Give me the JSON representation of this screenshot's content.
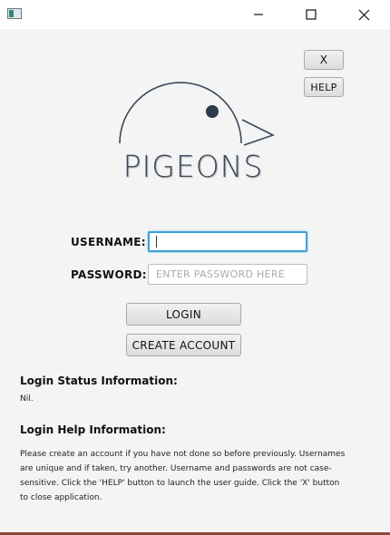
{
  "window": {
    "controls": {
      "minimize_icon": "minimize-icon",
      "maximize_icon": "maximize-icon",
      "close_icon": "close-icon"
    }
  },
  "header_buttons": {
    "close_label": "X",
    "help_label": "HELP"
  },
  "logo": {
    "text": "PIGEONS",
    "colors": {
      "stroke": "#3a4a5c",
      "eye": "#2b3a4c"
    }
  },
  "login_form": {
    "username_label": "USERNAME:",
    "username_value": "",
    "password_label": "PASSWORD:",
    "password_placeholder": "ENTER PASSWORD HERE",
    "login_button": "LOGIN",
    "create_account_button": "CREATE ACCOUNT"
  },
  "status": {
    "title": "Login Status Information:",
    "value": "Nil."
  },
  "help": {
    "title": "Login Help Information:",
    "text": "Please create an account if you have not done so before previously. Usernames are unique and if taken, try another. Username and passwords are not case-sensitive. Click the 'HELP' button to launch the user guide. Click the 'X' button to close application."
  },
  "colors": {
    "focus": "#3ca0d6",
    "background": "#f4f4f4",
    "bottom_border": "#8a4a3a"
  }
}
